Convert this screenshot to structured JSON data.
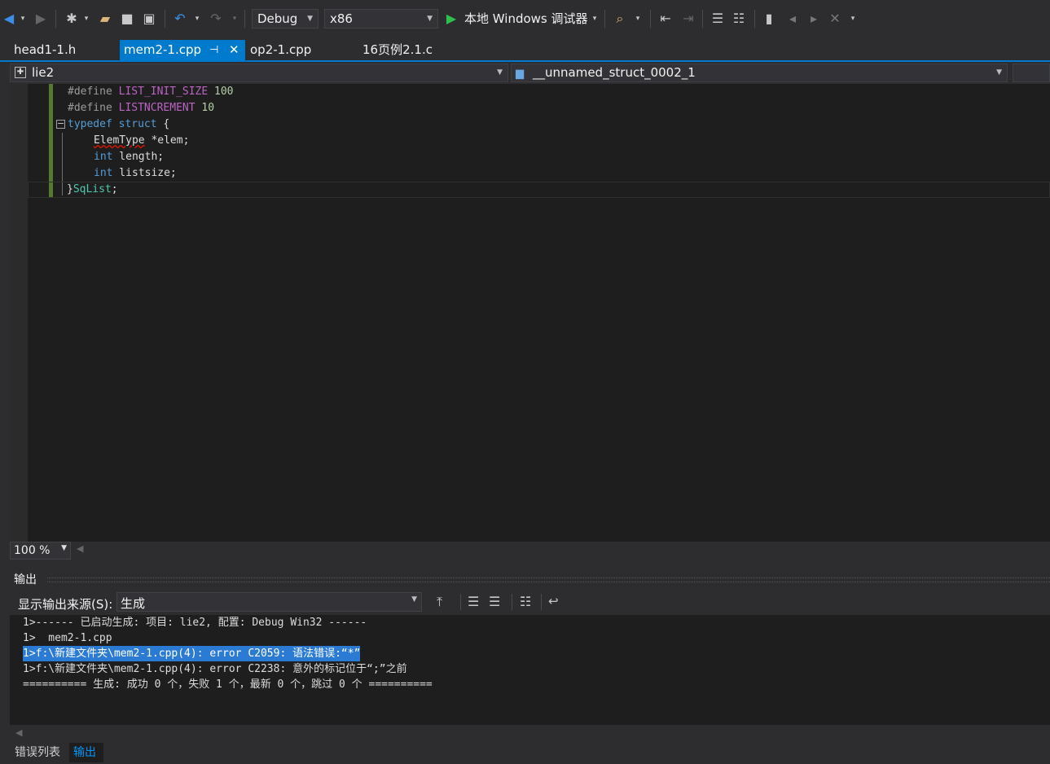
{
  "toolbar": {
    "config": "Debug",
    "platform": "x86",
    "run_label": "本地 Windows 调试器",
    "icons": [
      "back-icon",
      "forward-icon",
      "new-item-icon",
      "open-icon",
      "save-icon",
      "save-all-icon",
      "undo-icon",
      "redo-icon",
      "play-icon",
      "find-icon",
      "outdent-icon",
      "indent-icon",
      "comment-icon",
      "uncomment-icon",
      "bookmark-icon",
      "prev-bookmark-icon",
      "next-bookmark-icon",
      "clear-bookmarks-icon"
    ]
  },
  "tabs": [
    {
      "label": "head1-1.h"
    },
    {
      "label": "mem2-1.cpp"
    },
    {
      "label": "op2-1.cpp"
    },
    {
      "label": "16页例2.1.c"
    }
  ],
  "navbar": {
    "project": "lie2",
    "scope": "__unnamed_struct_0002_1"
  },
  "code": {
    "l1_directive": "#define",
    "l1_name": "LIST_INIT_SIZE",
    "l1_val": "100",
    "l2_directive": "#define",
    "l2_name": "LISTNCREMENT",
    "l2_val": "10",
    "l3_kw1": "typedef",
    "l3_kw2": "struct",
    "l3_brace": "{",
    "l4_type": "ElemType",
    "l4_rest": " *elem;",
    "l5_kw": "int",
    "l5_rest": " length;",
    "l6_kw": "int",
    "l6_rest": " listsize;",
    "l7_brace": "}",
    "l7_name": "SqList",
    "l7_semi": ";"
  },
  "zoom": "100 %",
  "output": {
    "title": "输出",
    "source_label": "显示输出来源(S):",
    "source_value": "生成",
    "lines": [
      "1>------ 已启动生成: 项目: lie2, 配置: Debug Win32 ------",
      "1>  mem2-1.cpp",
      "1>f:\\新建文件夹\\mem2-1.cpp(4): error C2059: 语法错误:“*”",
      "1>f:\\新建文件夹\\mem2-1.cpp(4): error C2238: 意外的标记位于“;”之前",
      "========== 生成: 成功 0 个，失败 1 个，最新 0 个，跳过 0 个 =========="
    ]
  },
  "bottom_tabs": [
    {
      "label": "错误列表"
    },
    {
      "label": "输出"
    }
  ],
  "colors": {
    "accent": "#007acc",
    "background": "#2d2d30",
    "editor_bg": "#1e1e1e",
    "selection": "#2b7bd4"
  }
}
